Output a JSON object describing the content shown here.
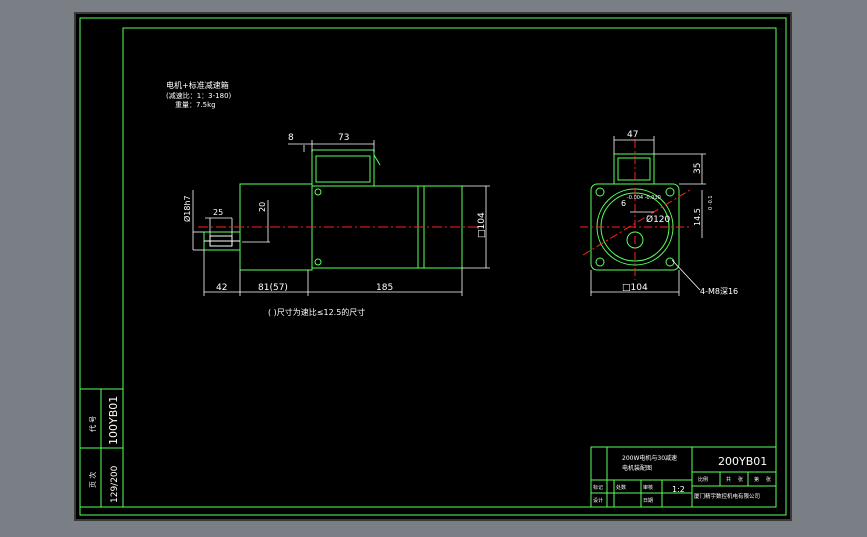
{
  "title_notes": {
    "line1": "电机+标准减速箱",
    "line2": "(减速比：1：3-180)",
    "line3": "重量：7.5kg"
  },
  "side_view": {
    "dim_top_small": "8",
    "dim_top_box": "73",
    "dim_shaft_dia": "Ø18h7",
    "dim_key": "25",
    "dim_key_height": "20",
    "dim_square": "□104",
    "dim_shaft_len": "42",
    "dim_mid": "81(57)",
    "dim_body": "185",
    "note": "( )尺寸为速比≤12.5的尺寸"
  },
  "front_view": {
    "dim_box_width": "47",
    "dim_box_height": "35",
    "dim_key_width": "6",
    "dim_key_width_tol": "-0.004 -0.030",
    "dim_pilot": "Ø120",
    "dim_key_depth": "14.5",
    "dim_key_depth_tol": "0 -0.1",
    "dim_square": "□104",
    "dim_holes": "4-M8深16"
  },
  "side_stamp": {
    "drawing_no": "100YB01",
    "page": "129/200",
    "label_a": "代 号",
    "label_b": "页 次"
  },
  "title_block": {
    "drawing_no": "200YB01",
    "description_1": "200W电机与30减速",
    "description_2": "电机装配图",
    "scale": "1:2",
    "company": "厦门精宇数控机电有限公司",
    "cells": [
      "标记",
      "处数",
      "设计",
      "审核",
      "日期",
      "比例",
      "共",
      "张",
      "第",
      "张"
    ]
  },
  "colors": {
    "canvas": "#7a7f86",
    "sheet": "#000000",
    "frame": "#5aff5a",
    "lines": "#ffffff",
    "centerline": "#ff2020",
    "dims": "#ffffff"
  }
}
